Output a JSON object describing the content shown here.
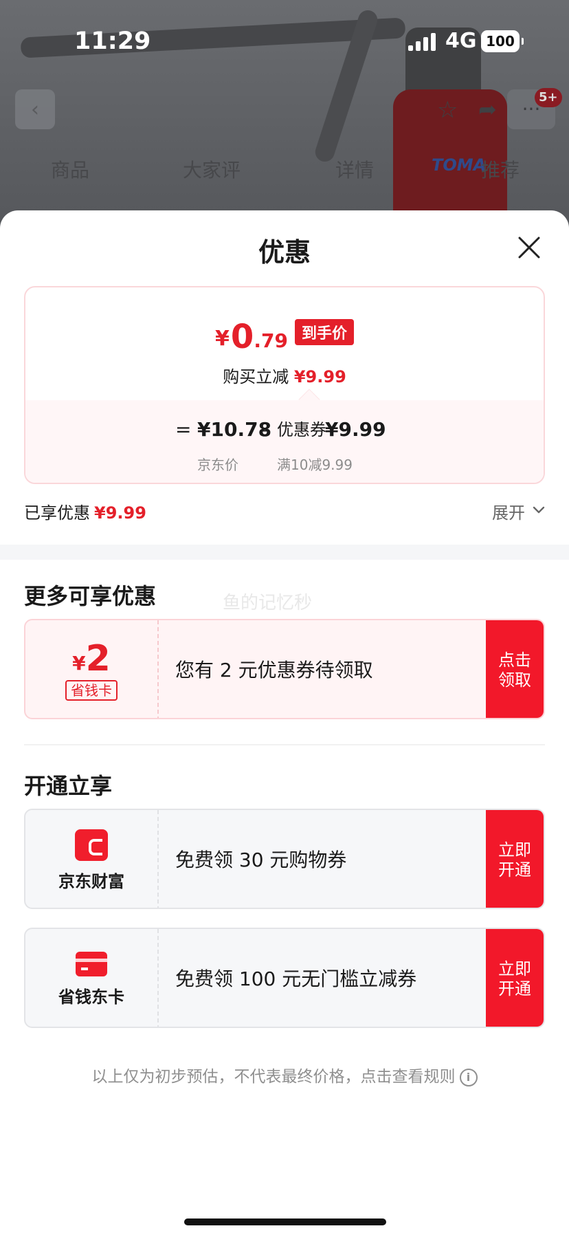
{
  "status_bar": {
    "time": "11:29",
    "network": "4G",
    "battery": "100"
  },
  "background": {
    "brand": "TOMA",
    "message_badge": "5+",
    "tabs": [
      "商品",
      "大家评",
      "详情",
      "推荐"
    ],
    "icons": [
      "chevron-left-icon",
      "star-icon",
      "share-icon",
      "more-icon"
    ]
  },
  "sheet": {
    "title": "优惠",
    "price_card": {
      "yen": "¥",
      "final_int": "0",
      "final_dec": ".79",
      "final_tag": "到手价",
      "instant_label": "购买立减",
      "instant_amount": "¥9.99",
      "eq": "=",
      "jd_price": "¥10.78",
      "minus": "–",
      "coupon_label": "优惠券",
      "coupon_amount": "¥9.99",
      "jd_price_label": "京东价",
      "coupon_rule": "满10减9.99"
    },
    "enjoyed_label": "已享优惠",
    "enjoyed_amount": "¥9.99",
    "expand_label": "展开",
    "more_offers_title": "更多可享优惠",
    "watermark": "鱼的记忆秒",
    "save_coupon": {
      "yen": "¥",
      "amount": "2",
      "tag": "省钱卡",
      "text": "您有 2 元优惠券待领取",
      "button": "点击领取"
    },
    "activate_title": "开通立享",
    "finance": {
      "brand": "京东财富",
      "text": "免费领 30 元购物券",
      "button": "立即开通"
    },
    "save_card": {
      "brand": "省钱东卡",
      "text": "免费领 100 元无门槛立减券",
      "button": "立即开通"
    },
    "disclaimer": "以上仅为初步预估，不代表最终价格，点击查看规则",
    "colors": {
      "accent": "#e4202a",
      "button": "#f2182a"
    }
  }
}
